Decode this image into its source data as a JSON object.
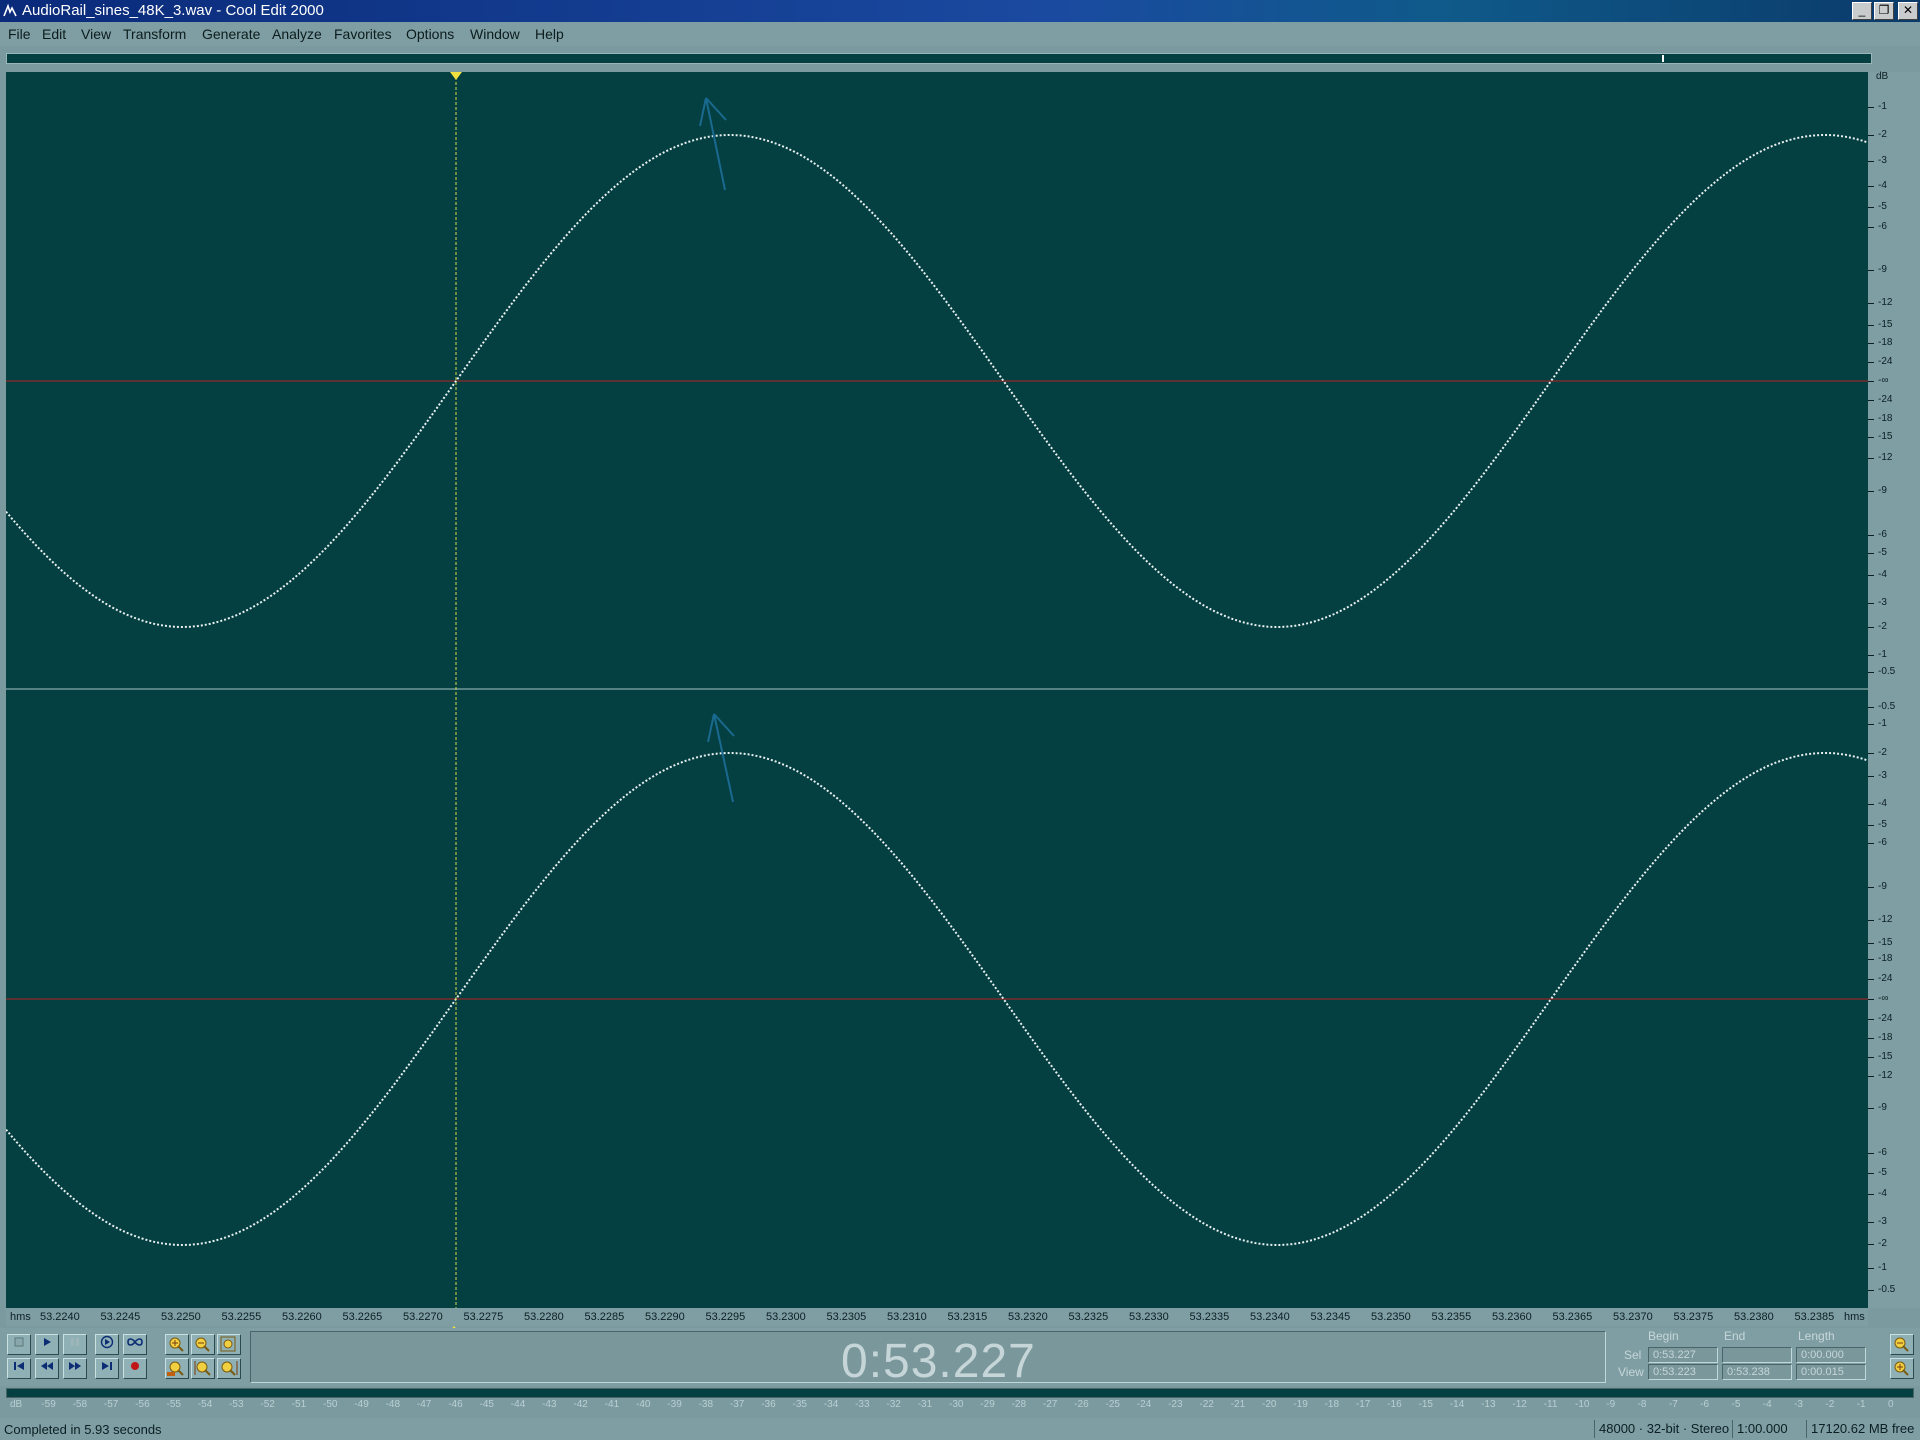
{
  "window": {
    "title": "AudioRail_sines_48K_3.wav - Cool Edit 2000",
    "controls": [
      "_",
      "❐",
      "✕"
    ]
  },
  "menu": [
    "File",
    "Edit",
    "View",
    "Transform",
    "Generate",
    "Analyze",
    "Favorites",
    "Options",
    "Window",
    "Help"
  ],
  "waveform": {
    "background": "#043f42",
    "wave_color": "#e8f0f0",
    "center_line_color": "#b02020",
    "cursor_color": "#d8d84a",
    "arrow_color": "#1a6a90",
    "channels": 2
  },
  "db_ruler": {
    "unit": "dB",
    "top_channel": [
      "-1",
      "-2",
      "-3",
      "-4",
      "-5",
      "-6",
      "-9",
      "-12",
      "-15",
      "-18",
      "-24",
      "-∞",
      "-24",
      "-18",
      "-15",
      "-12",
      "-9",
      "-6",
      "-5",
      "-4",
      "-3",
      "-2",
      "-1",
      "-0.5"
    ],
    "bottom_channel": [
      "-0.5",
      "-1",
      "-2",
      "-3",
      "-4",
      "-5",
      "-6",
      "-9",
      "-12",
      "-15",
      "-18",
      "-24",
      "-∞",
      "-24",
      "-18",
      "-15",
      "-12",
      "-9",
      "-6",
      "-5",
      "-4",
      "-3",
      "-2",
      "-1",
      "-0.5"
    ]
  },
  "time_ruler": {
    "unit_left": "hms",
    "unit_right": "hms",
    "ticks": [
      "53.2240",
      "53.2245",
      "53.2250",
      "53.2255",
      "53.2260",
      "53.2265",
      "53.2270",
      "53.2275",
      "53.2280",
      "53.2285",
      "53.2290",
      "53.2295",
      "53.2300",
      "53.2305",
      "53.2310",
      "53.2315",
      "53.2320",
      "53.2325",
      "53.2330",
      "53.2335",
      "53.2340",
      "53.2345",
      "53.2350",
      "53.2355",
      "53.2360",
      "53.2365",
      "53.2370",
      "53.2375",
      "53.2380",
      "53.2385"
    ]
  },
  "transport": {
    "current_time": "0:53.227",
    "headers": {
      "begin": "Begin",
      "end": "End",
      "length": "Length"
    },
    "sel": {
      "label": "Sel",
      "begin": "0:53.227",
      "end": "",
      "length": "0:00.000"
    },
    "view": {
      "label": "View",
      "begin": "0:53.223",
      "end": "0:53.238",
      "length": "0:00.015"
    }
  },
  "level_meter": {
    "labels": [
      "dB",
      "-59",
      "-58",
      "-57",
      "-56",
      "-55",
      "-54",
      "-53",
      "-52",
      "-51",
      "-50",
      "-49",
      "-48",
      "-47",
      "-46",
      "-45",
      "-44",
      "-43",
      "-42",
      "-41",
      "-40",
      "-39",
      "-38",
      "-37",
      "-36",
      "-35",
      "-34",
      "-33",
      "-32",
      "-31",
      "-30",
      "-29",
      "-28",
      "-27",
      "-26",
      "-25",
      "-24",
      "-23",
      "-22",
      "-21",
      "-20",
      "-19",
      "-18",
      "-17",
      "-16",
      "-15",
      "-14",
      "-13",
      "-12",
      "-11",
      "-10",
      "-9",
      "-8",
      "-7",
      "-6",
      "-5",
      "-4",
      "-3",
      "-2",
      "-1",
      "0"
    ]
  },
  "status": {
    "message": "Completed in 5.93 seconds",
    "format": "48000 · 32-bit · Stereo",
    "ratio": "1:00.000",
    "free": "17120.62 MB free"
  }
}
